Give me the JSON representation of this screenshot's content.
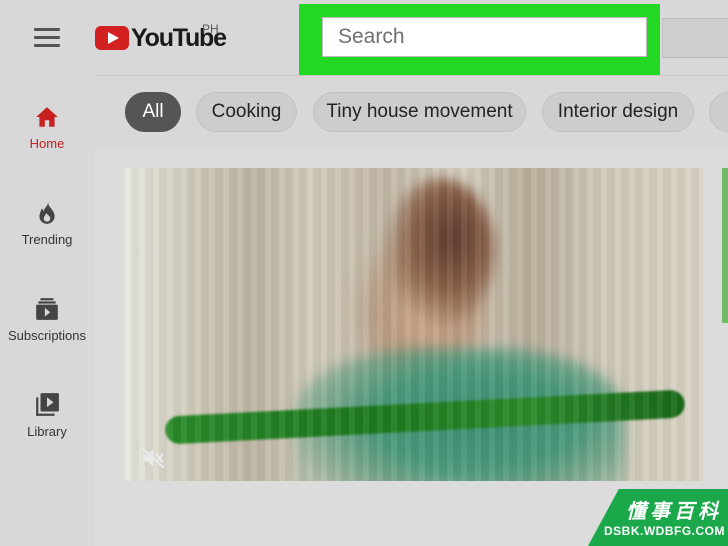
{
  "app": {
    "logo_text": "YouTube",
    "region": "PH"
  },
  "search": {
    "placeholder": "Search",
    "value": ""
  },
  "sidebar": {
    "items": [
      {
        "label": "Home",
        "icon": "home-icon",
        "active": true
      },
      {
        "label": "Trending",
        "icon": "trending-flame-icon",
        "active": false
      },
      {
        "label": "Subscriptions",
        "icon": "subscriptions-icon",
        "active": false
      },
      {
        "label": "Library",
        "icon": "library-icon",
        "active": false
      }
    ]
  },
  "chips": [
    {
      "label": "All",
      "active": true
    },
    {
      "label": "Cooking",
      "active": false
    },
    {
      "label": "Tiny house movement",
      "active": false
    },
    {
      "label": "Interior design",
      "active": false
    }
  ],
  "video": {
    "muted": true
  },
  "watermark": {
    "cn": "懂事百科",
    "en": "DSBK.WDBFG.COM"
  },
  "colors": {
    "highlight": "#22d822",
    "brand_red": "#d32020",
    "active_nav": "#c62020",
    "watermark_green": "#1aa84a"
  }
}
